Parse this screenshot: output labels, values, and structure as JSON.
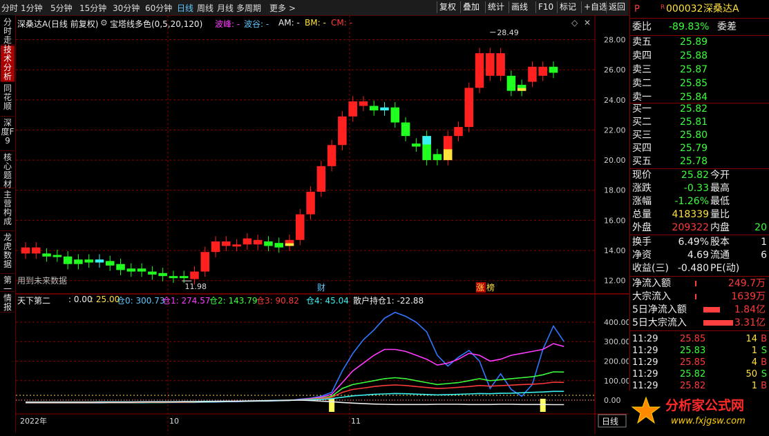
{
  "toolbar": {
    "periods": [
      "分时",
      "1分钟",
      "5分钟",
      "15分钟",
      "30分钟",
      "60分钟",
      "日线",
      "周线",
      "月线",
      "多周期",
      "更多 >"
    ],
    "active_period": "日线",
    "right_buttons": [
      "复权",
      "叠加",
      "统计",
      "画线",
      "F10",
      "标记",
      "+自选",
      "返回"
    ]
  },
  "sidebar": {
    "tabs": [
      "分时走势",
      "技术分析",
      "同花顺",
      "深度F9",
      "核心题材",
      "主营构成",
      "龙虎数据",
      "第一",
      "情报"
    ],
    "active_index": 1
  },
  "chart_header": {
    "title": "深桑达A(日线 前复权)",
    "indicator_name": "宝塔线多色(0,5,20,120)",
    "legend": [
      {
        "label": "波峰: -",
        "color": "#ff3bff"
      },
      {
        "label": "波谷: -",
        "color": "#5ec8ff"
      },
      {
        "label": "AM: -",
        "color": "#eeeeee"
      },
      {
        "label": "BM: -",
        "color": "#ffe23b"
      },
      {
        "label": "CM: -",
        "color": "#ff3b3b"
      }
    ],
    "max_label": "28.49",
    "min_label": "11.98",
    "future_note": "用到未来数据",
    "marker_cai": "财",
    "marker_zhang": "涨",
    "marker_bang": "榜"
  },
  "lower_header": {
    "name": "天下第二",
    "values": [
      {
        "label": ": 0.00",
        "color": "#eeeeee"
      },
      {
        "label": ": 25.00",
        "color": "#ffe23b"
      },
      {
        "label": "仓0: 300.73",
        "color": "#5ec8ff"
      },
      {
        "label": "仓1: 274.57",
        "color": "#ff3bff"
      },
      {
        "label": "仓2: 143.79",
        "color": "#3bff3b"
      },
      {
        "label": "仓3: 90.82",
        "color": "#ff3b3b"
      },
      {
        "label": "仓4: 45.04",
        "color": "#3bf0f0"
      },
      {
        "label": "散户持仓1: -22.88",
        "color": "#eeeeee"
      }
    ]
  },
  "xaxis": {
    "labels": [
      "2022年",
      "10",
      "11"
    ],
    "period_box": "日线"
  },
  "right_panel": {
    "code_prefix": "P",
    "r_mark": "R",
    "code": "000032",
    "name": "深桑达A",
    "weibi_label": "委比",
    "weibi_value": "-89.83%",
    "weicha_label": "委差",
    "asks": [
      {
        "label": "卖五",
        "price": "25.89"
      },
      {
        "label": "卖四",
        "price": "25.88"
      },
      {
        "label": "卖三",
        "price": "25.87"
      },
      {
        "label": "卖二",
        "price": "25.85"
      },
      {
        "label": "卖一",
        "price": "25.84"
      }
    ],
    "bids": [
      {
        "label": "买一",
        "price": "25.82"
      },
      {
        "label": "买二",
        "price": "25.81"
      },
      {
        "label": "买三",
        "price": "25.80"
      },
      {
        "label": "买四",
        "price": "25.79"
      },
      {
        "label": "买五",
        "price": "25.78"
      }
    ],
    "quote": [
      {
        "l1": "现价",
        "v1": "25.82",
        "c1": "dn",
        "l2": "今开",
        "v2": "",
        "c2": "wh"
      },
      {
        "l1": "涨跌",
        "v1": "-0.33",
        "c1": "dn",
        "l2": "最高",
        "v2": "",
        "c2": "wh"
      },
      {
        "l1": "涨幅",
        "v1": "-1.26%",
        "c1": "dn",
        "l2": "最低",
        "v2": "",
        "c2": "wh"
      },
      {
        "l1": "总量",
        "v1": "418339",
        "c1": "yl",
        "l2": "量比",
        "v2": "",
        "c2": "wh"
      },
      {
        "l1": "外盘",
        "v1": "209322",
        "c1": "up",
        "l2": "内盘",
        "v2": "20",
        "c2": "dn"
      }
    ],
    "stats": [
      {
        "l1": "换手",
        "v1": "6.49%",
        "l2": "股本",
        "v2": "1"
      },
      {
        "l1": "净资",
        "v1": "4.69",
        "l2": "流通",
        "v2": "6"
      },
      {
        "l1": "收益(三)",
        "v1": "-0.480",
        "l2": "PE(动)",
        "v2": ""
      }
    ],
    "flows": [
      {
        "label": "净流入额",
        "value": "249.7万",
        "bar": 0.02
      },
      {
        "label": "大宗流入",
        "value": "1639万",
        "bar": 0.02
      },
      {
        "label": "5日净流入额",
        "value": "1.84亿",
        "bar": 0.5
      },
      {
        "label": "5日大宗流入",
        "value": "3.31亿",
        "bar": 0.9
      }
    ],
    "ticks": [
      {
        "time": "11:29",
        "price": "25.85",
        "vol": "14",
        "flag": "B"
      },
      {
        "time": "11:29",
        "price": "25.83",
        "vol": "1",
        "flag": "S"
      },
      {
        "time": "11:29",
        "price": "25.85",
        "vol": "4",
        "flag": "B"
      },
      {
        "time": "11:29",
        "price": "25.82",
        "vol": "50",
        "flag": "S"
      },
      {
        "time": "11:29",
        "price": "25.82",
        "vol": "1",
        "flag": "B"
      }
    ],
    "logo_text": "分析家公式网",
    "logo_url": "www.fxjgsw.com"
  },
  "colors": {
    "up": "#ff2020",
    "down": "#20ff20",
    "cyan": "#3bf0f0",
    "yellow": "#ffe23b",
    "grid": "#8a0000"
  },
  "chart_data": [
    {
      "type": "candlestick",
      "title": "宝塔线多色(0,5,20,120)",
      "yticks": [
        12.0,
        14.0,
        16.0,
        18.0,
        20.0,
        22.0,
        24.0,
        26.0,
        28.0
      ],
      "ylim": [
        11.3,
        28.8
      ],
      "bars": [
        {
          "o": 14.2,
          "c": 13.8,
          "color": "up"
        },
        {
          "o": 14.2,
          "c": 13.8,
          "color": "up"
        },
        {
          "o": 13.8,
          "c": 13.6,
          "color": "down"
        },
        {
          "o": 13.7,
          "c": 13.6,
          "color": "down"
        },
        {
          "o": 13.6,
          "c": 13.1,
          "color": "down"
        },
        {
          "o": 13.4,
          "c": 13.1,
          "color": "down"
        },
        {
          "o": 13.4,
          "c": 13.2,
          "color": "down"
        },
        {
          "o": 13.4,
          "c": 13.2,
          "color": "cyan"
        },
        {
          "o": 13.3,
          "c": 13.0,
          "color": "down"
        },
        {
          "o": 13.1,
          "c": 12.7,
          "color": "down"
        },
        {
          "o": 12.8,
          "c": 12.6,
          "color": "down"
        },
        {
          "o": 12.8,
          "c": 12.6,
          "color": "down"
        },
        {
          "o": 12.6,
          "c": 12.4,
          "color": "down"
        },
        {
          "o": 12.5,
          "c": 12.3,
          "color": "down"
        },
        {
          "o": 12.3,
          "c": 12.2,
          "color": "down"
        },
        {
          "o": 12.3,
          "c": 12.2,
          "color": "down"
        },
        {
          "o": 12.1,
          "c": 12.6,
          "color": "up"
        },
        {
          "o": 12.6,
          "c": 13.9,
          "color": "up"
        },
        {
          "o": 13.9,
          "c": 14.6,
          "color": "up"
        },
        {
          "o": 14.6,
          "c": 14.3,
          "color": "up"
        },
        {
          "o": 14.3,
          "c": 14.4,
          "color": "up"
        },
        {
          "o": 14.4,
          "c": 14.8,
          "color": "up"
        },
        {
          "o": 14.4,
          "c": 14.7,
          "color": "up"
        },
        {
          "o": 14.6,
          "c": 14.3,
          "color": "down"
        },
        {
          "o": 14.5,
          "c": 14.2,
          "color": "down"
        },
        {
          "o": 14.3,
          "c": 14.7,
          "color": "up",
          "tail": "yellow"
        },
        {
          "o": 14.7,
          "c": 16.4,
          "color": "up"
        },
        {
          "o": 16.4,
          "c": 17.9,
          "color": "up"
        },
        {
          "o": 17.9,
          "c": 19.6,
          "color": "up"
        },
        {
          "o": 19.6,
          "c": 21.0,
          "color": "up"
        },
        {
          "o": 21.0,
          "c": 22.9,
          "color": "up"
        },
        {
          "o": 22.9,
          "c": 23.9,
          "color": "up"
        },
        {
          "o": 23.9,
          "c": 23.6,
          "color": "up"
        },
        {
          "o": 23.6,
          "c": 23.3,
          "color": "down"
        },
        {
          "o": 23.5,
          "c": 23.3,
          "color": "cyan"
        },
        {
          "o": 23.5,
          "c": 22.5,
          "color": "down"
        },
        {
          "o": 22.5,
          "c": 21.6,
          "color": "down"
        },
        {
          "o": 21.1,
          "c": 20.9,
          "color": "down"
        },
        {
          "o": 21.6,
          "c": 20.0,
          "color": "down",
          "head": "cyan"
        },
        {
          "o": 20.0,
          "c": 20.4,
          "color": "down"
        },
        {
          "o": 20.0,
          "c": 21.6,
          "color": "up",
          "tail": "yellow"
        },
        {
          "o": 21.6,
          "c": 22.2,
          "color": "up"
        },
        {
          "o": 22.2,
          "c": 24.8,
          "color": "up"
        },
        {
          "o": 24.8,
          "c": 27.1,
          "color": "up"
        },
        {
          "o": 27.1,
          "c": 25.6,
          "color": "up"
        },
        {
          "o": 27.1,
          "c": 25.6,
          "color": "up"
        },
        {
          "o": 25.6,
          "c": 24.6,
          "color": "down"
        },
        {
          "o": 25.0,
          "c": 24.6,
          "color": "down",
          "tail": "yellow"
        },
        {
          "o": 25.2,
          "c": 26.2,
          "color": "up"
        },
        {
          "o": 26.2,
          "c": 25.6,
          "color": "up"
        },
        {
          "o": 26.2,
          "c": 25.8,
          "color": "down"
        }
      ]
    },
    {
      "type": "line",
      "title": "天下第二",
      "yticks": [
        0.0,
        100.0,
        200.0,
        300.0,
        400.0
      ],
      "ylim": [
        -60,
        460
      ],
      "series": [
        {
          "name": "仓0",
          "color": "#2f78ff",
          "values": [
            -15,
            -15,
            -15,
            -15,
            -15,
            -15,
            -15,
            -15,
            -14,
            -14,
            -14,
            -14,
            -13,
            -13,
            -12,
            -12,
            -12,
            -10,
            -10,
            -8,
            -8,
            -6,
            -5,
            -5,
            -3,
            -2,
            5,
            10,
            20,
            40,
            150,
            240,
            310,
            360,
            420,
            450,
            430,
            400,
            350,
            230,
            175,
            220,
            255,
            200,
            60,
            135,
            55,
            20,
            80,
            260,
            380,
            300
          ]
        },
        {
          "name": "仓1",
          "color": "#ff3bff",
          "values": [
            -12,
            -12,
            -12,
            -12,
            -12,
            -12,
            -12,
            -11,
            -11,
            -11,
            -11,
            -10,
            -10,
            -10,
            -9,
            -9,
            -8,
            -7,
            -6,
            -5,
            -5,
            -4,
            -3,
            -3,
            -2,
            -1,
            3,
            8,
            15,
            30,
            90,
            150,
            190,
            230,
            260,
            260,
            250,
            230,
            210,
            180,
            190,
            210,
            240,
            230,
            200,
            210,
            230,
            240,
            250,
            260,
            290,
            275
          ]
        },
        {
          "name": "仓2",
          "color": "#3bff3b",
          "values": [
            -14,
            -14,
            -14,
            -14,
            -14,
            -14,
            -14,
            -13,
            -13,
            -13,
            -13,
            -12,
            -12,
            -12,
            -11,
            -11,
            -10,
            -9,
            -8,
            -7,
            -6,
            -5,
            -4,
            -3,
            -2,
            -1,
            2,
            5,
            10,
            20,
            60,
            80,
            90,
            100,
            110,
            115,
            110,
            100,
            90,
            80,
            85,
            90,
            100,
            110,
            100,
            105,
            110,
            115,
            120,
            130,
            145,
            144
          ]
        },
        {
          "name": "仓3",
          "color": "#ff3b3b",
          "values": [
            -13,
            -13,
            -13,
            -13,
            -13,
            -13,
            -13,
            -12,
            -12,
            -12,
            -12,
            -11,
            -11,
            -11,
            -10,
            -10,
            -9,
            -8,
            -7,
            -6,
            -5,
            -4,
            -3,
            -2,
            -1,
            0,
            2,
            4,
            8,
            15,
            40,
            55,
            62,
            70,
            75,
            78,
            75,
            70,
            65,
            60,
            62,
            66,
            70,
            75,
            72,
            74,
            77,
            80,
            82,
            85,
            92,
            91
          ]
        },
        {
          "name": "仓4",
          "color": "#3bf0f0",
          "values": [
            -10,
            -10,
            -10,
            -10,
            -10,
            -10,
            -10,
            -9,
            -9,
            -9,
            -9,
            -9,
            -8,
            -8,
            -8,
            -7,
            -7,
            -6,
            -6,
            -5,
            -5,
            -4,
            -3,
            -2,
            -1,
            0,
            1,
            2,
            4,
            8,
            15,
            22,
            26,
            30,
            32,
            34,
            33,
            31,
            29,
            27,
            28,
            30,
            32,
            34,
            33,
            35,
            36,
            38,
            40,
            42,
            45,
            45
          ]
        },
        {
          "name": "散户持仓1",
          "color": "#eeeeee",
          "values": [
            -10,
            -10,
            -10,
            -10,
            -10,
            -10,
            -10,
            -10,
            -10,
            -10,
            -10,
            -9,
            -9,
            -9,
            -9,
            -8,
            -8,
            -8,
            -7,
            -7,
            -6,
            -5,
            -4,
            -3,
            -2,
            -1,
            0,
            -2,
            -5,
            -8,
            -12,
            -15,
            -18,
            -20,
            -21,
            -22,
            -22,
            -22,
            -22,
            -21,
            -21,
            -21,
            -22,
            -22,
            -22,
            -21,
            -21,
            -22,
            -22,
            -22,
            -23,
            -23
          ]
        }
      ],
      "signal_bars": [
        {
          "index": 29,
          "color": "#ffff60"
        },
        {
          "index": 49,
          "color": "#ffff60"
        }
      ]
    }
  ]
}
